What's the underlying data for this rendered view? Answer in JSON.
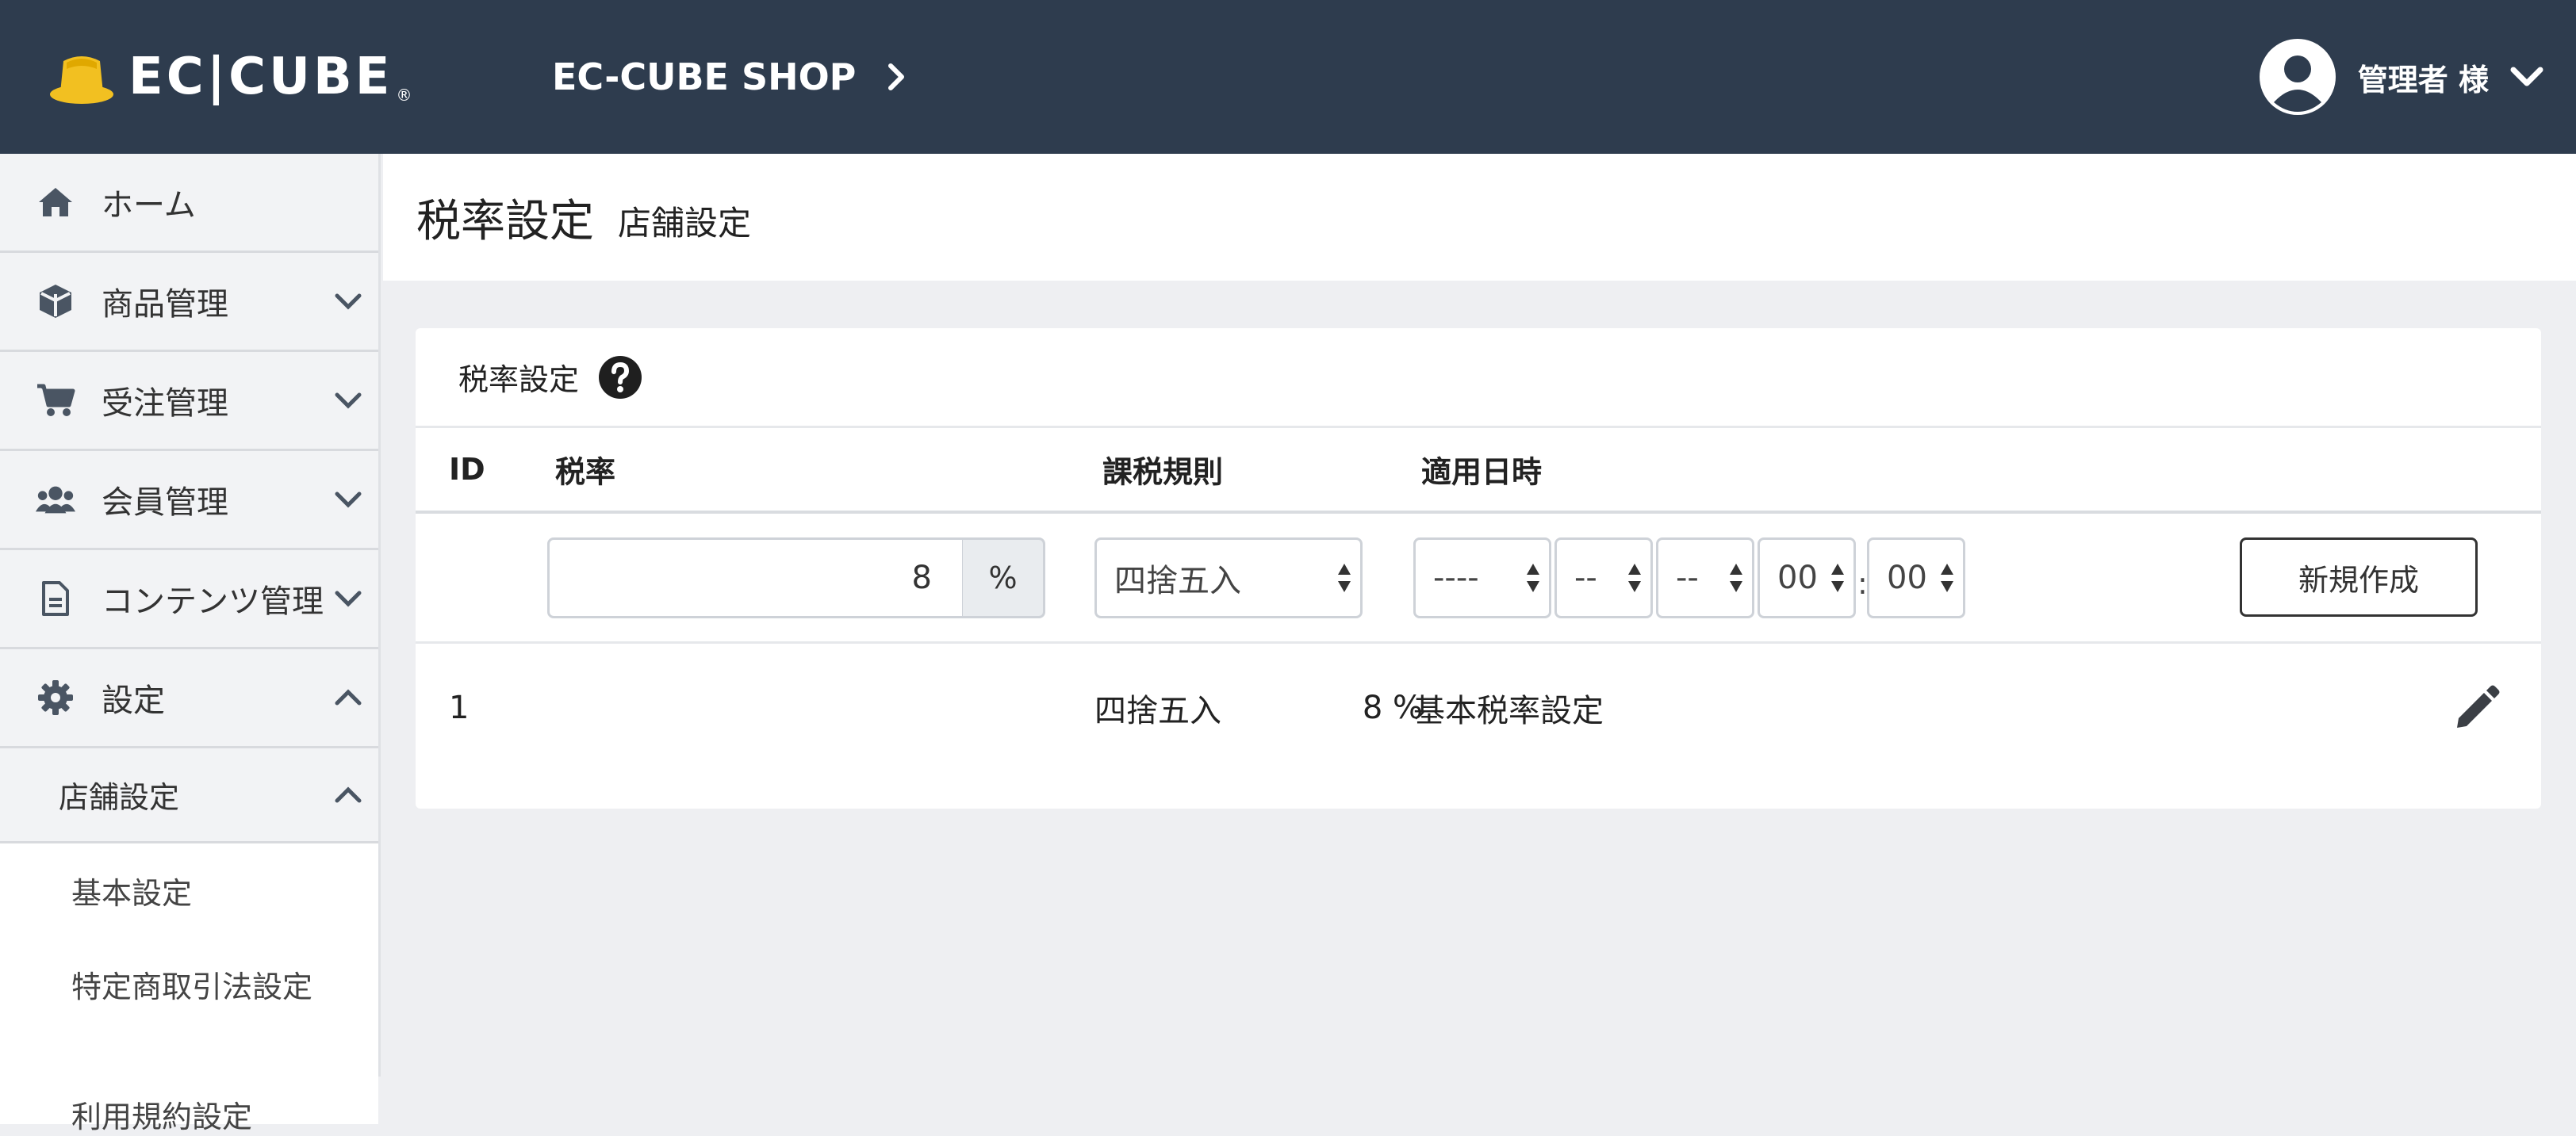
{
  "header": {
    "logo_text": "EC|CUBE",
    "logo_mark": "®",
    "shop_name": "EC-CUBE SHOP",
    "user_name": "管理者 様"
  },
  "sidebar": {
    "items": [
      {
        "label": "ホーム",
        "icon": "home-icon"
      },
      {
        "label": "商品管理",
        "icon": "box-icon"
      },
      {
        "label": "受注管理",
        "icon": "cart-icon"
      },
      {
        "label": "会員管理",
        "icon": "users-icon"
      },
      {
        "label": "コンテンツ管理",
        "icon": "file-icon"
      },
      {
        "label": "設定",
        "icon": "gear-icon"
      }
    ],
    "sub_group": "店舗設定",
    "leaves": [
      "基本設定",
      "特定商取引法設定",
      "利用規約設定"
    ]
  },
  "page": {
    "title": "税率設定",
    "subtitle": "店舗設定"
  },
  "card": {
    "title": "税率設定",
    "columns": [
      "ID",
      "税率",
      "課税規則",
      "適用日時"
    ],
    "form": {
      "rate_value": "8",
      "rate_unit": "%",
      "rule": "四捨五入",
      "year": "----",
      "month": "--",
      "day": "--",
      "hour": "00",
      "minute": "00",
      "time_sep": ":",
      "submit_label": "新規作成"
    },
    "rows": [
      {
        "id": "1",
        "rate": "8 %",
        "rule": "四捨五入",
        "applied": "基本税率設定"
      }
    ]
  },
  "colors": {
    "header_bg": "#2e3c4e",
    "accent_gold": "#f2c021",
    "page_bg": "#eeeff2"
  }
}
